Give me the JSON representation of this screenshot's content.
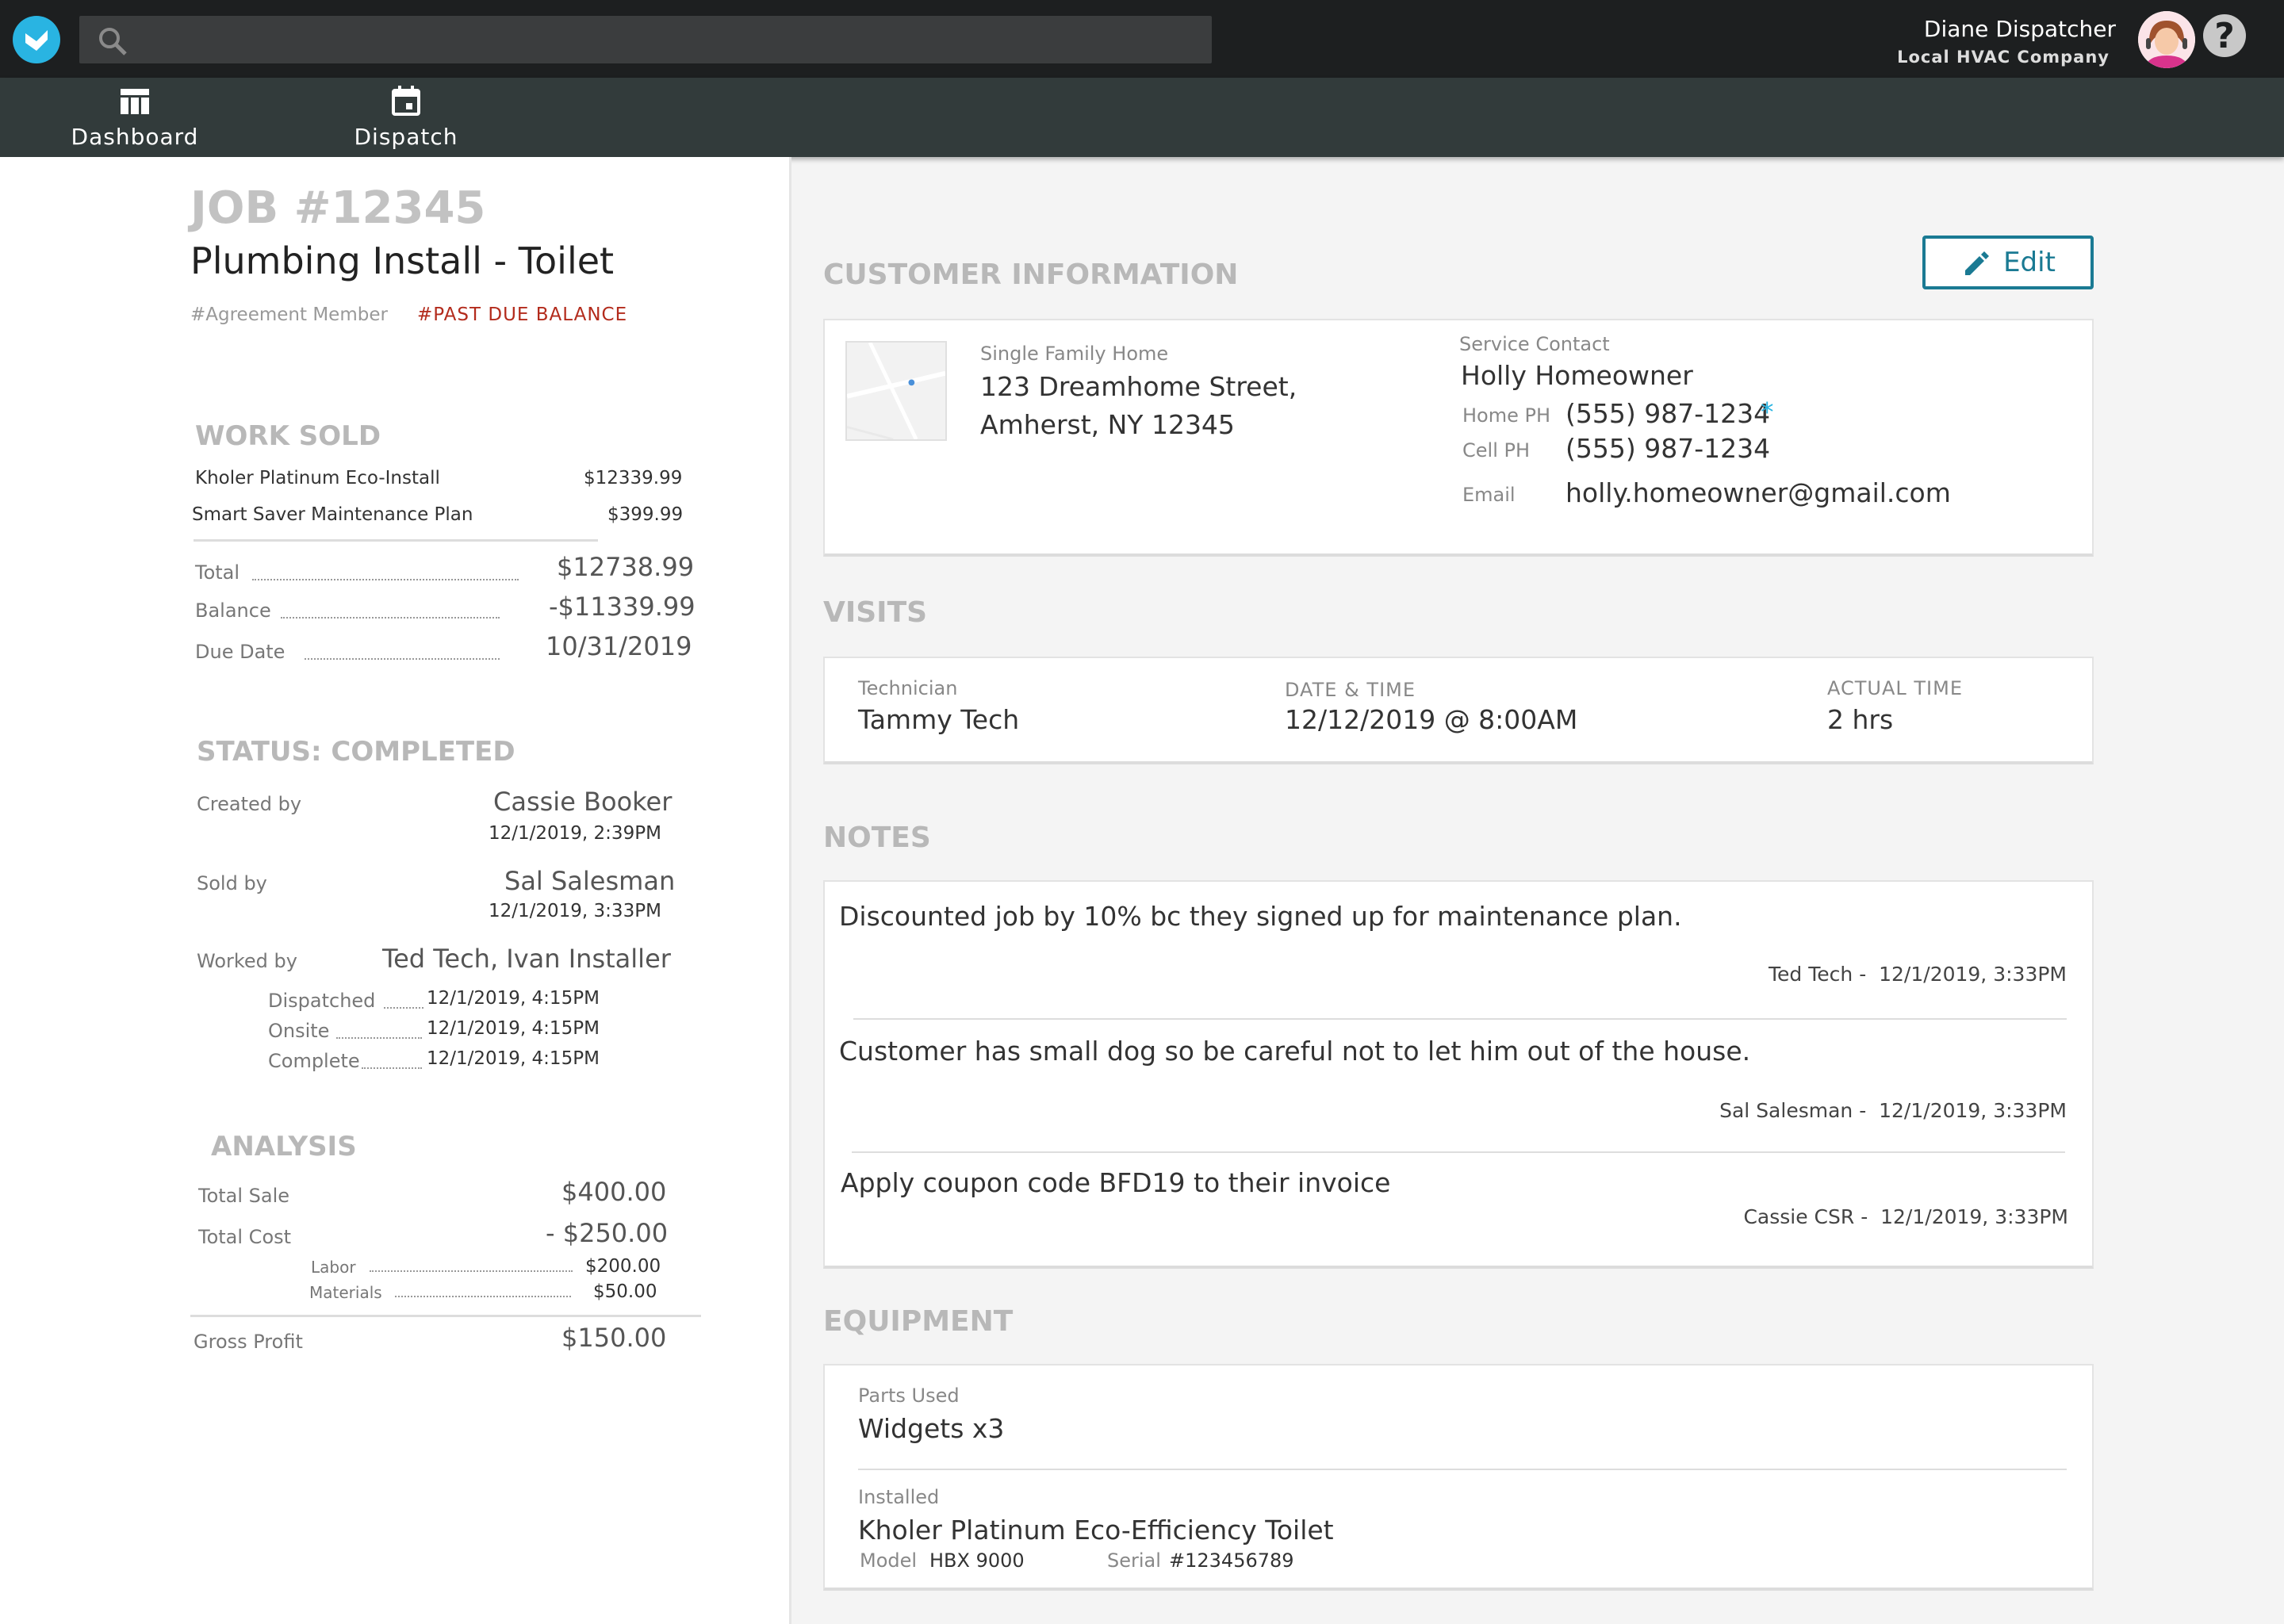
{
  "header": {
    "search_placeholder": "",
    "user_name": "Diane Dispatcher",
    "company": "Local HVAC Company",
    "help_symbol": "?"
  },
  "nav": {
    "items": [
      {
        "label": "Dashboard",
        "icon": "dashboard-icon"
      },
      {
        "label": "Dispatch",
        "icon": "calendar-icon"
      }
    ]
  },
  "job": {
    "number": "JOB #12345",
    "title": "Plumbing Install - Toilet",
    "tags": [
      "#Agreement Member",
      "#PAST DUE BALANCE"
    ]
  },
  "work_sold": {
    "heading": "WORK SOLD",
    "items": [
      {
        "name": "Kholer Platinum Eco-Install",
        "price": "$12339.99"
      },
      {
        "name": "Smart Saver Maintenance Plan",
        "price": "$399.99"
      }
    ],
    "total_label": "Total",
    "total": "$12738.99",
    "balance_label": "Balance",
    "balance": "-$11339.99",
    "due_label": "Due Date",
    "due": "10/31/2019"
  },
  "status": {
    "heading": "STATUS: COMPLETED",
    "created_label": "Created by",
    "created_name": "Cassie Booker",
    "created_time": "12/1/2019, 2:39PM",
    "sold_label": "Sold by",
    "sold_name": "Sal Salesman",
    "sold_time": "12/1/2019, 3:33PM",
    "worked_label": "Worked by",
    "worked_names": "Ted Tech, Ivan Installer",
    "dispatched_label": "Dispatched",
    "dispatched_time": "12/1/2019, 4:15PM",
    "onsite_label": "Onsite",
    "onsite_time": "12/1/2019, 4:15PM",
    "complete_label": "Complete",
    "complete_time": "12/1/2019, 4:15PM"
  },
  "analysis": {
    "heading": "ANALYSIS",
    "sale_label": "Total Sale",
    "sale": "$400.00",
    "cost_label": "Total Cost",
    "cost": "- $250.00",
    "labor_label": "Labor",
    "labor": "$200.00",
    "materials_label": "Materials",
    "materials": "$50.00",
    "profit_label": "Gross Profit",
    "profit": "$150.00"
  },
  "customer": {
    "heading": "CUSTOMER INFORMATION",
    "edit_label": "Edit",
    "property_type": "Single Family Home",
    "address1": "123 Dreamhome Street,",
    "address2": "Amherst, NY 12345",
    "contact_label": "Service Contact",
    "contact_name": "Holly Homeowner",
    "home_label": "Home PH",
    "home": "(555) 987-1234",
    "primary_mark": "*",
    "cell_label": "Cell PH",
    "cell": "(555) 987-1234",
    "email_label": "Email",
    "email": "holly.homeowner@gmail.com"
  },
  "visits": {
    "heading": "VISITS",
    "tech_label": "Technician",
    "tech": "Tammy Tech",
    "date_label": "DATE & TIME",
    "date": "12/12/2019 @ 8:00AM",
    "actual_label": "ACTUAL TIME",
    "actual": "2 hrs"
  },
  "notes": {
    "heading": "NOTES",
    "items": [
      {
        "text": "Discounted job by 10% bc they signed up for maintenance plan.",
        "author": "Ted Tech -",
        "time": "12/1/2019, 3:33PM"
      },
      {
        "text": "Customer has small dog so be careful not to let him out of the house.",
        "author": "Sal Salesman -",
        "time": "12/1/2019, 3:33PM"
      },
      {
        "text": "Apply coupon code BFD19 to their invoice",
        "author": "Cassie CSR -",
        "time": "12/1/2019, 3:33PM"
      }
    ]
  },
  "equipment": {
    "heading": "EQUIPMENT",
    "parts_label": "Parts Used",
    "parts": "Widgets x3",
    "installed_label": "Installed",
    "installed": "Kholer Platinum Eco-Efficiency Toilet",
    "model_label": "Model",
    "model": "HBX 9000",
    "serial_label": "Serial",
    "serial": "#123456789"
  },
  "colors": {
    "accent": "#1a7a93",
    "brand": "#29b4e2",
    "alert": "#b32b1c"
  }
}
